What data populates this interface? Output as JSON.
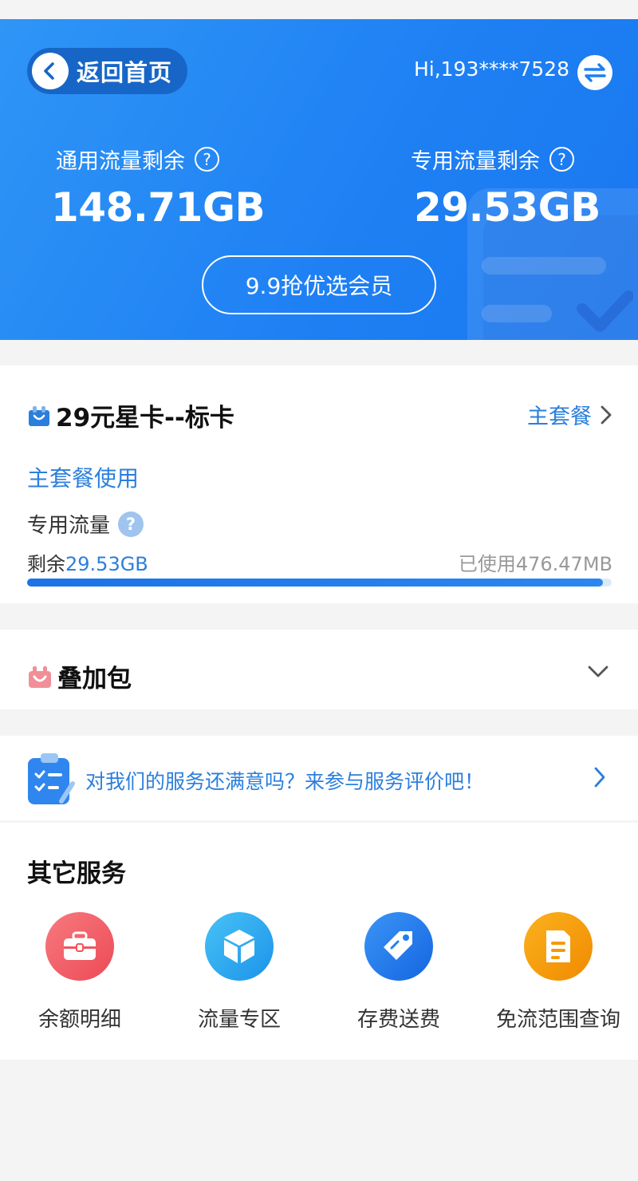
{
  "header": {
    "back_label": "返回首页",
    "user_greeting": "Hi,193****7528",
    "general_label": "通用流量剩余",
    "general_value": "148.71GB",
    "special_label": "专用流量剩余",
    "special_value": "29.53GB",
    "help_glyph": "?",
    "vip_button": "9.9抢优选会员"
  },
  "plan": {
    "name": "29元星卡--标卡",
    "link_label": "主套餐",
    "section_label": "主套餐使用",
    "flow_label": "专用流量",
    "help_glyph": "?",
    "remaining_prefix": "剩余",
    "remaining_value": "29.53GB",
    "used_prefix": "已使用",
    "used_value": "476.47MB",
    "progress_fraction": 0.985
  },
  "addon": {
    "title": "叠加包"
  },
  "survey": {
    "text": "对我们的服务还满意吗？来参与服务评价吧！"
  },
  "services": {
    "title": "其它服务",
    "items": [
      {
        "label": "余额明细",
        "icon": "briefcase-icon",
        "color": "#f0555d"
      },
      {
        "label": "流量专区",
        "icon": "cube-icon",
        "color": "#2aa6ef"
      },
      {
        "label": "存费送费",
        "icon": "price-tag-icon",
        "color": "#1f7ef2"
      },
      {
        "label": "免流范围查询",
        "icon": "document-icon",
        "color": "#f59a0b"
      }
    ]
  },
  "colors": {
    "brand": "#1e7ff3",
    "link": "#2b7fdc"
  }
}
